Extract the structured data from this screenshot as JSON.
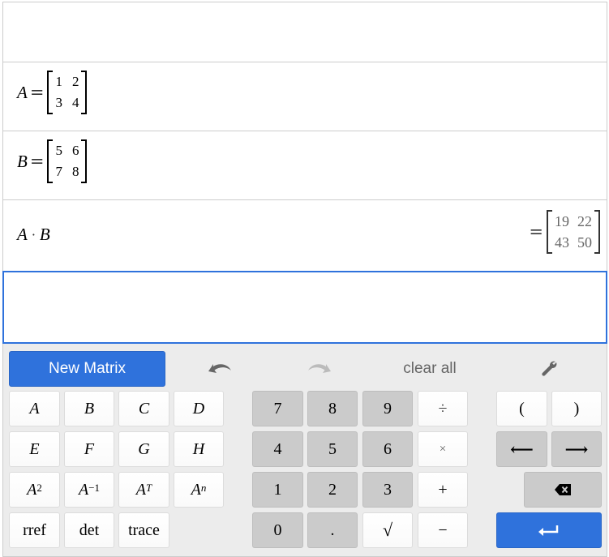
{
  "expressions": {
    "empty_row": "",
    "row_a": {
      "name": "A",
      "equals": "=",
      "matrix": [
        [
          "1",
          "2"
        ],
        [
          "3",
          "4"
        ]
      ]
    },
    "row_b": {
      "name": "B",
      "equals": "=",
      "matrix": [
        [
          "5",
          "6"
        ],
        [
          "7",
          "8"
        ]
      ]
    },
    "row_product": {
      "left": "A",
      "operator": "·",
      "right": "B",
      "equals": "=",
      "result": [
        [
          "19",
          "22"
        ],
        [
          "43",
          "50"
        ]
      ]
    },
    "active_input": ""
  },
  "keypad": {
    "new_matrix_label": "New Matrix",
    "undo_icon": "undo-arrow",
    "redo_icon": "redo-arrow",
    "clear_all_label": "clear all",
    "settings_icon": "wrench",
    "matrix_keys": [
      "A",
      "B",
      "C",
      "D",
      "E",
      "F",
      "G",
      "H"
    ],
    "power_keys": [
      {
        "base": "A",
        "sup": "2"
      },
      {
        "base": "A",
        "sup": "−1"
      },
      {
        "base": "A",
        "sup": "T"
      },
      {
        "base": "A",
        "sup": "n"
      }
    ],
    "function_keys": [
      "rref",
      "det",
      "trace"
    ],
    "digits": [
      "7",
      "8",
      "9",
      "4",
      "5",
      "6",
      "1",
      "2",
      "3",
      "0",
      "."
    ],
    "operators": {
      "divide": "÷",
      "times": "×",
      "plus": "+",
      "minus": "−",
      "sqrt": "√"
    },
    "parens": {
      "open": "(",
      "close": ")"
    },
    "arrows": {
      "left": "⟵",
      "right": "⟶"
    },
    "backspace_icon": "backspace",
    "enter_icon": "enter-return"
  },
  "colors": {
    "accent": "#2f72dc",
    "keypad_bg": "#ececec",
    "gray_key": "#cbcbcb"
  }
}
